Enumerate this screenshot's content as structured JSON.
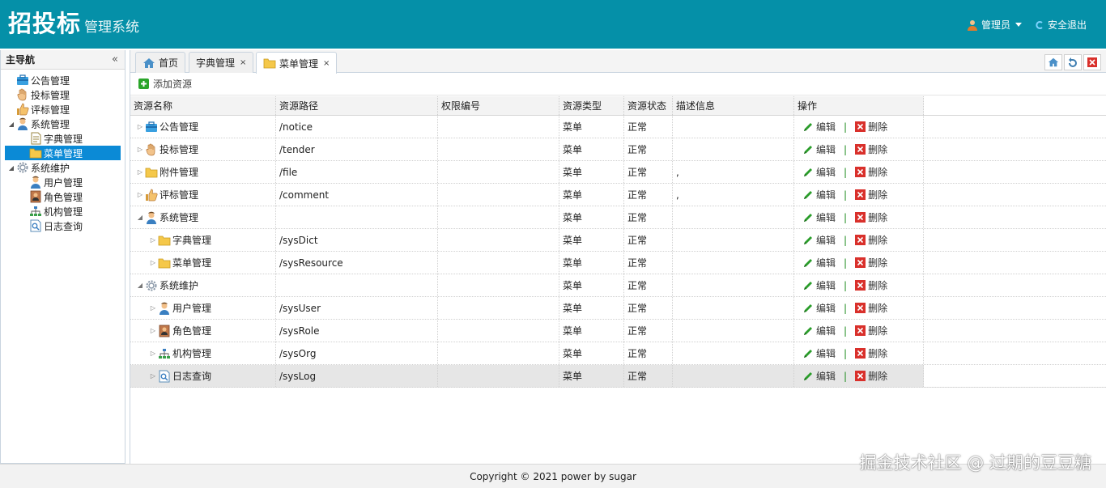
{
  "header": {
    "brand_main": "招投标",
    "brand_sub": "管理系统",
    "user_label": "管理员",
    "logout_label": "安全退出"
  },
  "sidebar": {
    "title": "主导航",
    "collapse_glyph": "«",
    "nodes": [
      {
        "label": "公告管理",
        "icon": "briefcase-icon",
        "level": 0
      },
      {
        "label": "投标管理",
        "icon": "hand-icon",
        "level": 0
      },
      {
        "label": "评标管理",
        "icon": "thumbs-up-icon",
        "level": 0
      },
      {
        "label": "系统管理",
        "icon": "user-icon",
        "level": 0,
        "expanded": true
      },
      {
        "label": "字典管理",
        "icon": "document-icon",
        "level": 1
      },
      {
        "label": "菜单管理",
        "icon": "folder-icon",
        "level": 1,
        "selected": true
      },
      {
        "label": "系统维护",
        "icon": "gear-icon",
        "level": 0,
        "expanded": true
      },
      {
        "label": "用户管理",
        "icon": "user-icon",
        "level": 1
      },
      {
        "label": "角色管理",
        "icon": "role-icon",
        "level": 1
      },
      {
        "label": "机构管理",
        "icon": "org-icon",
        "level": 1
      },
      {
        "label": "日志查询",
        "icon": "log-icon",
        "level": 1
      }
    ]
  },
  "tabs": [
    {
      "label": "首页",
      "icon": "home-icon",
      "closable": false
    },
    {
      "label": "字典管理",
      "closable": true
    },
    {
      "label": "菜单管理",
      "icon": "folder-icon",
      "closable": true,
      "active": true
    }
  ],
  "tab_close_glyph": "×",
  "toolbar": {
    "add_label": "添加资源"
  },
  "grid": {
    "columns": [
      "资源名称",
      "资源路径",
      "权限编号",
      "资源类型",
      "资源状态",
      "描述信息",
      "操作"
    ],
    "edit_label": "编辑",
    "delete_label": "删除",
    "separator": "|",
    "rows": [
      {
        "name": "公告管理",
        "icon": "briefcase-icon",
        "level": 0,
        "toggle": "▷",
        "path": "/notice",
        "perm": "",
        "type": "菜单",
        "state": "正常",
        "desc": ""
      },
      {
        "name": "投标管理",
        "icon": "hand-icon",
        "level": 0,
        "toggle": "▷",
        "path": "/tender",
        "perm": "",
        "type": "菜单",
        "state": "正常",
        "desc": ""
      },
      {
        "name": "附件管理",
        "icon": "folder-icon",
        "level": 0,
        "toggle": "▷",
        "path": "/file",
        "perm": "",
        "type": "菜单",
        "state": "正常",
        "desc": ","
      },
      {
        "name": "评标管理",
        "icon": "thumbs-up-icon",
        "level": 0,
        "toggle": "▷",
        "path": "/comment",
        "perm": "",
        "type": "菜单",
        "state": "正常",
        "desc": ","
      },
      {
        "name": "系统管理",
        "icon": "user-icon",
        "level": 0,
        "toggle": "◢",
        "path": "",
        "perm": "",
        "type": "菜单",
        "state": "正常",
        "desc": ""
      },
      {
        "name": "字典管理",
        "icon": "folder-icon",
        "level": 1,
        "toggle": "▷",
        "path": "/sysDict",
        "perm": "",
        "type": "菜单",
        "state": "正常",
        "desc": ""
      },
      {
        "name": "菜单管理",
        "icon": "folder-icon",
        "level": 1,
        "toggle": "▷",
        "path": "/sysResource",
        "perm": "",
        "type": "菜单",
        "state": "正常",
        "desc": ""
      },
      {
        "name": "系统维护",
        "icon": "gear-icon",
        "level": 0,
        "toggle": "◢",
        "path": "",
        "perm": "",
        "type": "菜单",
        "state": "正常",
        "desc": ""
      },
      {
        "name": "用户管理",
        "icon": "user-icon",
        "level": 1,
        "toggle": "▷",
        "path": "/sysUser",
        "perm": "",
        "type": "菜单",
        "state": "正常",
        "desc": ""
      },
      {
        "name": "角色管理",
        "icon": "role-icon",
        "level": 1,
        "toggle": "▷",
        "path": "/sysRole",
        "perm": "",
        "type": "菜单",
        "state": "正常",
        "desc": ""
      },
      {
        "name": "机构管理",
        "icon": "org-icon",
        "level": 1,
        "toggle": "▷",
        "path": "/sysOrg",
        "perm": "",
        "type": "菜单",
        "state": "正常",
        "desc": ""
      },
      {
        "name": "日志查询",
        "icon": "log-icon",
        "level": 1,
        "toggle": "▷",
        "path": "/sysLog",
        "perm": "",
        "type": "菜单",
        "state": "正常",
        "desc": "",
        "highlight": true
      }
    ]
  },
  "footer": {
    "copyright": "Copyright © 2021 power by sugar"
  },
  "watermark": "掘金技术社区 @ 过期的豆豆糖",
  "colors": {
    "header_bg": "#0590a8",
    "selected_bg": "#0b8ad6",
    "edit_green": "#2a9d2a",
    "delete_red": "#d9302b"
  }
}
